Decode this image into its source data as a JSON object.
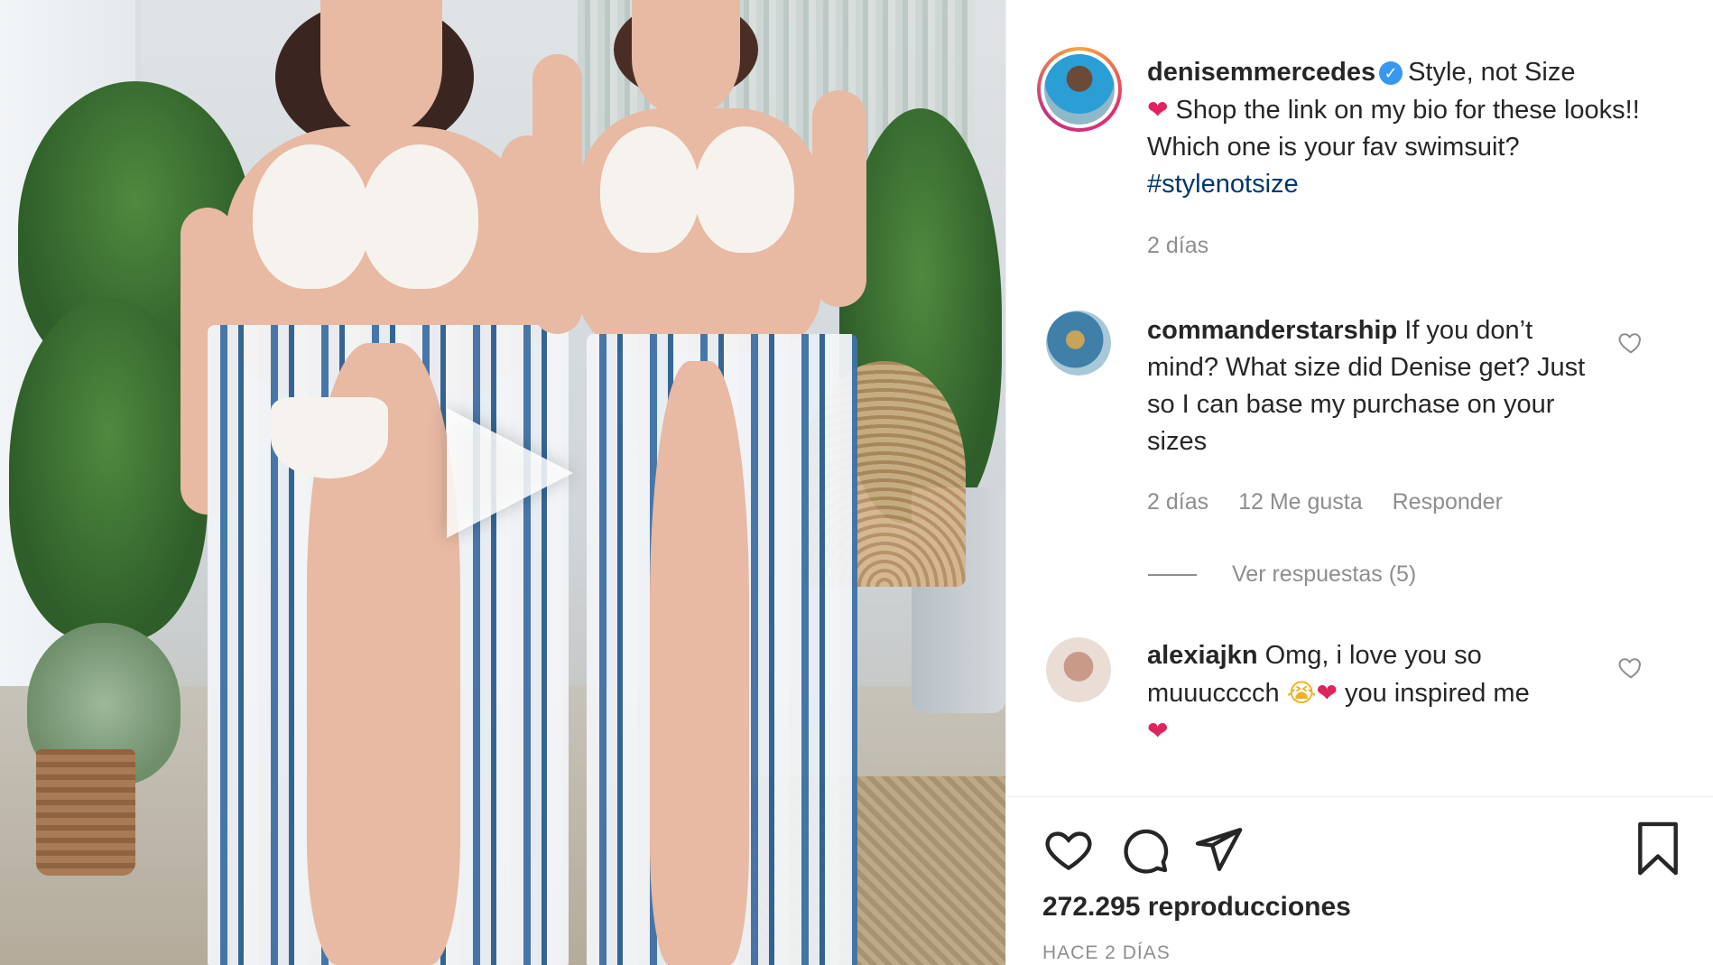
{
  "post": {
    "author": "denisemmercedes",
    "caption_part1": "Style, not Size",
    "caption_part2": "Shop the link on my bio for these looks!! Which one is your fav swimsuit?",
    "hashtag": "#stylenotsize",
    "time": "2 días"
  },
  "comments": [
    {
      "username": "commanderstarship",
      "text": "If you don’t mind? What size did Denise get? Just so I can base my purchase on your sizes",
      "time": "2 días",
      "likes": "12 Me gusta",
      "reply_label": "Responder",
      "view_replies": "Ver respuestas (5)"
    },
    {
      "username": "alexiajkn",
      "text_part1": "Omg, i love you so muuucccch",
      "text_part2": "you inspired me"
    }
  ],
  "footer": {
    "views": "272.295 reproducciones",
    "time_ago": "HACE 2 DÍAS"
  },
  "icons": {
    "like": "heart-outline-icon",
    "comment": "comment-bubble-icon",
    "share": "paper-plane-icon",
    "save": "bookmark-icon",
    "play": "play-icon"
  },
  "colors": {
    "verified": "#3897f0",
    "hashtag": "#00376b",
    "meta": "#8e8e8e",
    "heart_emoji": "#e0245e"
  }
}
